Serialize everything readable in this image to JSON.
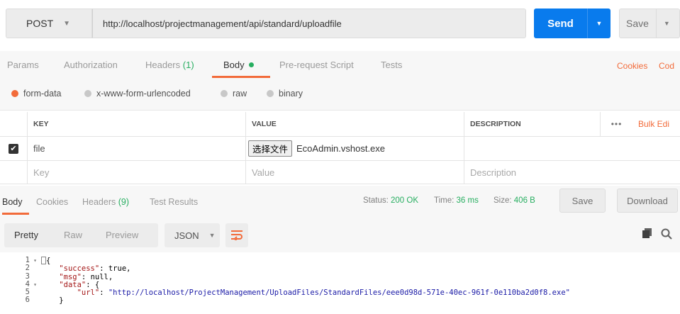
{
  "request": {
    "method": "POST",
    "url": "http://localhost/projectmanagement/api/standard/uploadfile",
    "send_label": "Send",
    "save_label": "Save"
  },
  "request_tabs": {
    "params": "Params",
    "authorization": "Authorization",
    "headers": "Headers",
    "headers_count": "(1)",
    "body": "Body",
    "prerequest": "Pre-request Script",
    "tests": "Tests",
    "cookies": "Cookies",
    "code": "Cod"
  },
  "body_types": {
    "form_data": "form-data",
    "urlencoded": "x-www-form-urlencoded",
    "raw": "raw",
    "binary": "binary",
    "selected": "form-data"
  },
  "kv_table": {
    "headers": {
      "key": "KEY",
      "value": "VALUE",
      "description": "DESCRIPTION",
      "more": "•••",
      "bulk_edit": "Bulk Edi"
    },
    "row1": {
      "key": "file",
      "file_button": "选择文件",
      "file_name": "EcoAdmin.vshost.exe",
      "checked": true
    },
    "new_row": {
      "key_placeholder": "Key",
      "value_placeholder": "Value",
      "description_placeholder": "Description"
    }
  },
  "response_tabs": {
    "body": "Body",
    "cookies": "Cookies",
    "headers": "Headers",
    "headers_count": "(9)",
    "test_results": "Test Results"
  },
  "status": {
    "status_label": "Status:",
    "status_value": "200 OK",
    "time_label": "Time:",
    "time_value": "36 ms",
    "size_label": "Size:",
    "size_value": "406 B",
    "save_label": "Save",
    "download_label": "Download"
  },
  "view": {
    "pretty": "Pretty",
    "raw": "Raw",
    "preview": "Preview",
    "format": "JSON"
  },
  "code": {
    "line_numbers": [
      "1",
      "2",
      "3",
      "4",
      "5",
      "6"
    ],
    "l1": "{",
    "l2_key": "\"success\"",
    "l2_val": "true,",
    "l3_key": "\"msg\"",
    "l3_val": "null,",
    "l4_key": "\"data\"",
    "l4_val": "{",
    "l5_key": "\"url\"",
    "l5_val": "\"http://localhost/ProjectManagement/UploadFiles/StandardFiles/eee0d98d-571e-40ec-961f-0e110ba2d0f8.exe\"",
    "l6": "}"
  },
  "colors": {
    "accent": "#f26b3a",
    "send_blue": "#097bed",
    "ok_green": "#27ae60"
  },
  "icons": [
    "chevron-down-icon",
    "wrap-lines-icon",
    "copy-icon",
    "search-icon",
    "checkbox-checked-icon"
  ]
}
